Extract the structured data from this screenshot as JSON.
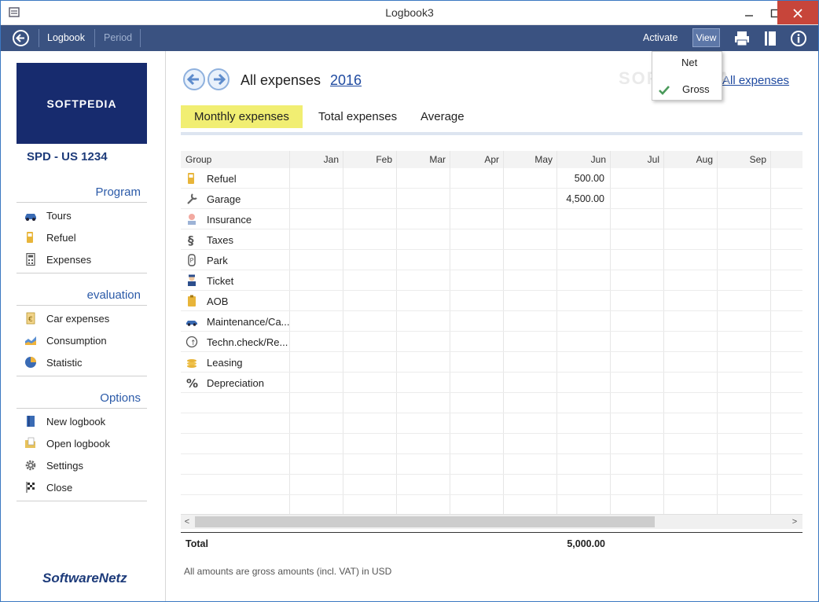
{
  "window": {
    "title": "Logbook3"
  },
  "toolbar": {
    "logbook": "Logbook",
    "period": "Period",
    "activate": "Activate",
    "view": "View"
  },
  "view_menu": {
    "items": [
      "Net",
      "Gross"
    ],
    "checked": "Gross"
  },
  "sidebar": {
    "logo_text": "SOFTPEDIA",
    "car_id": "SPD - US 1234",
    "sections": {
      "program": {
        "title": "Program",
        "items": [
          "Tours",
          "Refuel",
          "Expenses"
        ]
      },
      "evaluation": {
        "title": "evaluation",
        "items": [
          "Car expenses",
          "Consumption",
          "Statistic"
        ]
      },
      "options": {
        "title": "Options",
        "items": [
          "New logbook",
          "Open logbook",
          "Settings",
          "Close"
        ]
      }
    },
    "brand": "SoftwareNetz"
  },
  "main": {
    "title": "All expenses",
    "year": "2016",
    "filter_link": "All expenses",
    "tabs": [
      "Monthly expenses",
      "Total expenses",
      "Average"
    ],
    "active_tab": "Monthly expenses",
    "grid": {
      "headers": [
        "Group",
        "Jan",
        "Feb",
        "Mar",
        "Apr",
        "May",
        "Jun",
        "Jul",
        "Aug",
        "Sep"
      ],
      "rows": [
        {
          "label": "Refuel",
          "icon": "fuel-pump-icon",
          "jun": "500.00"
        },
        {
          "label": "Garage",
          "icon": "wrench-icon",
          "jun": "4,500.00"
        },
        {
          "label": "Insurance",
          "icon": "insurance-icon",
          "jun": ""
        },
        {
          "label": "Taxes",
          "icon": "taxes-icon",
          "jun": ""
        },
        {
          "label": "Park",
          "icon": "parking-icon",
          "jun": ""
        },
        {
          "label": "Ticket",
          "icon": "police-icon",
          "jun": ""
        },
        {
          "label": "AOB",
          "icon": "clipboard-icon",
          "jun": ""
        },
        {
          "label": "Maintenance/Ca...",
          "icon": "car-icon",
          "jun": ""
        },
        {
          "label": "Techn.check/Re...",
          "icon": "inspection-icon",
          "jun": ""
        },
        {
          "label": "Leasing",
          "icon": "coins-icon",
          "jun": ""
        },
        {
          "label": "Depreciation",
          "icon": "percent-icon",
          "jun": ""
        }
      ]
    },
    "total_label": "Total",
    "total_value": "5,000.00",
    "note": "All amounts are gross amounts (incl. VAT) in USD"
  },
  "watermark": "SOFTPEDIA",
  "colors": {
    "toolbar": "#3a5281",
    "active_tab": "#f1ee72",
    "link": "#1f4aa0",
    "close_button": "#c7453a"
  }
}
